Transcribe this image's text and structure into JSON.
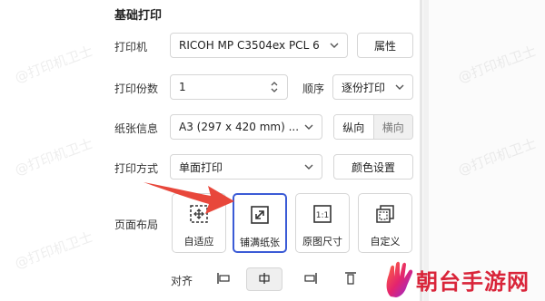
{
  "section": {
    "title": "基础打印"
  },
  "watermark": {
    "text": "@打印机卫士"
  },
  "printer": {
    "label": "打印机",
    "value": "RICOH MP C3504ex PCL 6",
    "properties_button": "属性"
  },
  "copies": {
    "label": "打印份数",
    "value": "1",
    "order_label": "顺序",
    "order_value": "逐份打印"
  },
  "paper": {
    "label": "纸张信息",
    "value": "A3 (297 x 420 mm) ...",
    "portrait": "纵向",
    "landscape": "横向",
    "selected_orientation": "portrait"
  },
  "mode": {
    "label": "打印方式",
    "value": "单面打印",
    "color_settings_button": "颜色设置"
  },
  "layout": {
    "label": "页面布局",
    "options": [
      {
        "caption": "自适应",
        "icon": "fit-adaptive-icon",
        "selected": false
      },
      {
        "caption": "铺满纸张",
        "icon": "fill-paper-icon",
        "selected": true
      },
      {
        "caption": "原图尺寸",
        "icon": "original-size-icon",
        "selected": false
      },
      {
        "caption": "自定义",
        "icon": "custom-size-icon",
        "selected": false
      }
    ]
  },
  "alignment": {
    "label": "对齐",
    "options": [
      {
        "icon": "align-left-icon",
        "selected": false
      },
      {
        "icon": "align-center-icon",
        "selected": true
      },
      {
        "icon": "align-right-icon",
        "selected": false
      },
      {
        "icon": "align-top-icon",
        "selected": false
      }
    ]
  },
  "brand": {
    "text": "朝台手游网",
    "color": "#d9253a"
  },
  "colors": {
    "accent": "#3b5bd6",
    "arrow": "#e8473b"
  }
}
